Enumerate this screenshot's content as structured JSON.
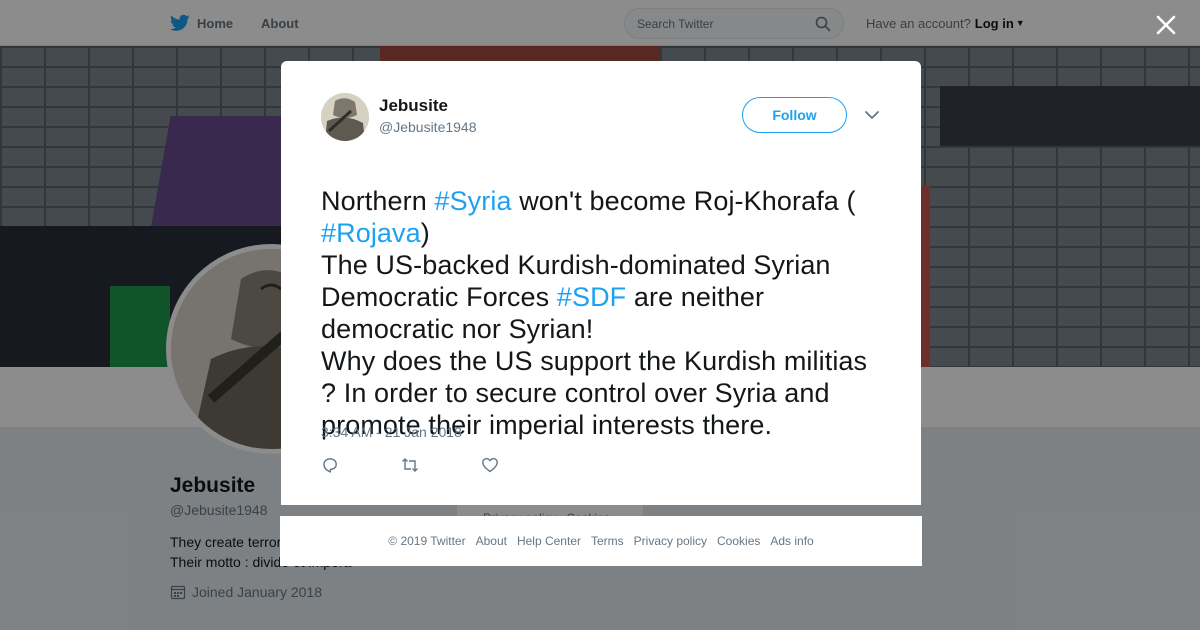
{
  "nav": {
    "home_label": "Home",
    "about_label": "About",
    "search_placeholder": "Search Twitter",
    "account_prompt": "Have an account?",
    "login_label": "Log in"
  },
  "profile": {
    "name": "Jebusite",
    "handle": "@Jebusite1948",
    "bio": "They create terror… with terrorism. Their motto : divide et impera",
    "joined": "Joined January 2018",
    "side_card_text": "Privacy policy   Cookies"
  },
  "tweet": {
    "author_name": "Jebusite",
    "author_handle": "@Jebusite1948",
    "follow_label": "Follow",
    "text_segments": [
      {
        "text": "Northern ",
        "hashtag": false
      },
      {
        "text": "#Syria",
        "hashtag": true
      },
      {
        "text": " won't become Roj-Khorafa (\n",
        "hashtag": false
      },
      {
        "text": "#Rojava",
        "hashtag": true
      },
      {
        "text": ")\nThe US-backed Kurdish-dominated Syrian Democratic Forces ",
        "hashtag": false
      },
      {
        "text": "#SDF",
        "hashtag": true
      },
      {
        "text": " are neither democratic nor Syrian!\nWhy does the US support the Kurdish militias ? In order to secure control over Syria and promote their imperial interests there.",
        "hashtag": false
      }
    ],
    "timestamp": "3:34 AM - 21 Jan 2018"
  },
  "footer": {
    "links": [
      "© 2019 Twitter",
      "About",
      "Help Center",
      "Terms",
      "Privacy policy",
      "Cookies",
      "Ads info"
    ]
  },
  "colors": {
    "brand": "#1da1f2",
    "text_primary": "#14171a",
    "text_secondary": "#657786"
  },
  "icons": {
    "nav_logo": "twitter-bird-icon",
    "search": "search-icon",
    "close": "close-icon",
    "more": "chevron-down-icon",
    "reply": "reply-icon",
    "retweet": "retweet-icon",
    "like": "heart-icon",
    "joined": "calendar-icon"
  }
}
